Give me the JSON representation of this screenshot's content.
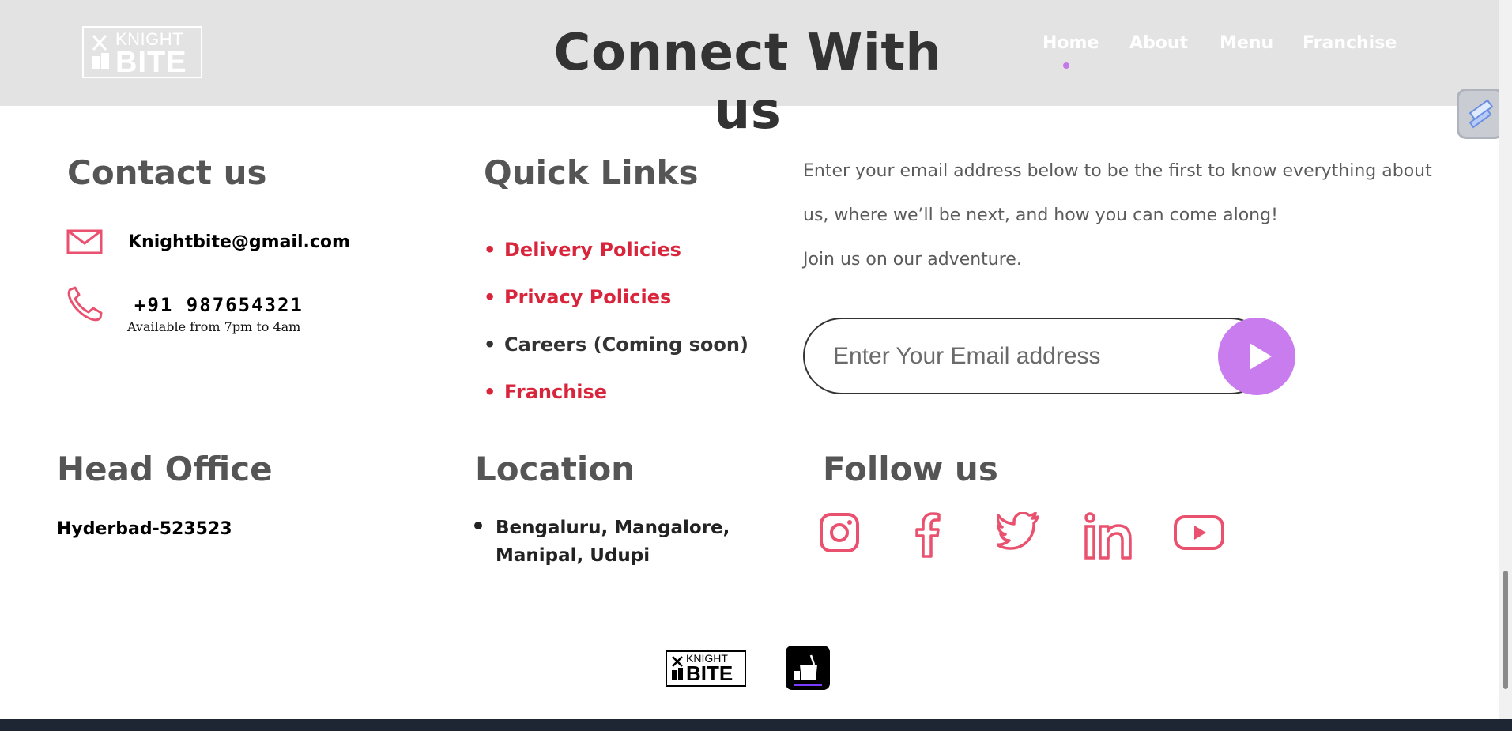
{
  "header": {
    "logo_top": "KNIGHT",
    "logo_bottom": "BITE",
    "title": "Connect With us",
    "nav": [
      {
        "label": "Home",
        "active": true
      },
      {
        "label": "About"
      },
      {
        "label": "Menu"
      },
      {
        "label": "Franchise"
      }
    ],
    "accent_color": "#c479e8"
  },
  "contact": {
    "heading": "Contact us",
    "email": "Knightbite@gmail.com",
    "phone": "+91 987654321",
    "availability": "Available from 7pm to 4am",
    "icons": [
      "mail-icon",
      "phone-icon"
    ],
    "icon_color": "#e9516f"
  },
  "quick_links": {
    "heading": "Quick Links",
    "items": [
      {
        "label": "Delivery Policies",
        "color": "#d9253c"
      },
      {
        "label": "Privacy Policies",
        "color": "#d9253c"
      },
      {
        "label": "Careers (Coming soon)",
        "color": "#333333"
      },
      {
        "label": "Franchise",
        "color": "#d9253c"
      }
    ]
  },
  "newsletter": {
    "line1": "Enter your email address below to be the first to know everything about",
    "line2": "us, where we’ll be next, and how you can come along!",
    "line3": "Join us on our adventure.",
    "placeholder": "Enter Your Email address",
    "button_icon": "play-icon",
    "button_color": "#c97ced"
  },
  "head_office": {
    "heading": "Head Office",
    "address": "Hyderbad-523523"
  },
  "location": {
    "heading": "Location",
    "line1": "Bengaluru, Mangalore,",
    "line2": "Manipal, Udupi"
  },
  "follow": {
    "heading": "Follow us",
    "icons": [
      "instagram-icon",
      "facebook-icon",
      "twitter-icon",
      "linkedin-icon",
      "youtube-icon"
    ],
    "color": "#e9516f"
  },
  "footer": {
    "logo_top": "KNIGHT",
    "logo_bottom": "BITE"
  }
}
